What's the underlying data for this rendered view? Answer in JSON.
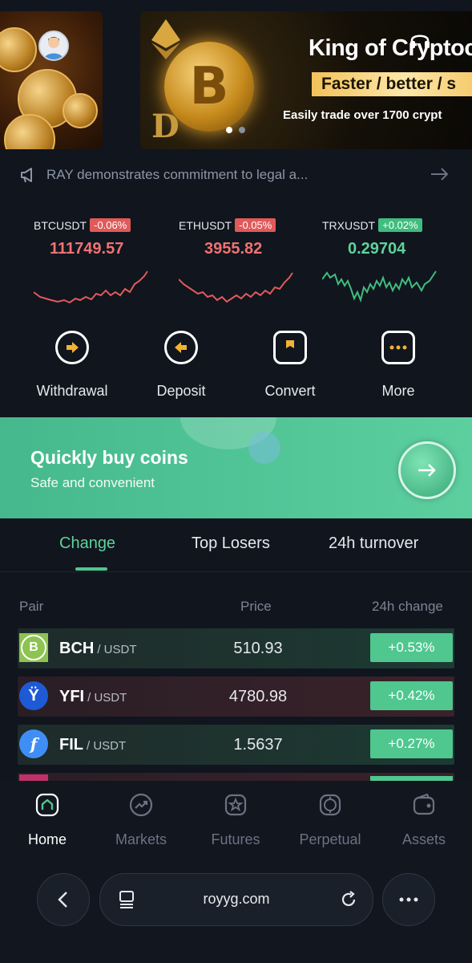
{
  "banner": {
    "title": "King of Cryptocu",
    "strip": "Faster / better  /  s",
    "subtitle": "Easily trade over 1700 crypt",
    "coin_glyph": "B",
    "active_slide": 1,
    "slide_count": 2
  },
  "announcement": {
    "text": "RAY demonstrates commitment to legal a..."
  },
  "tickers": [
    {
      "symbol": "BTCUSDT",
      "change": "-0.06%",
      "price": "111749.57",
      "direction": "down"
    },
    {
      "symbol": "ETHUSDT",
      "change": "-0.05%",
      "price": "3955.82",
      "direction": "down"
    },
    {
      "symbol": "TRXUSDT",
      "change": "+0.02%",
      "price": "0.29704",
      "direction": "up"
    }
  ],
  "actions": [
    {
      "label": "Withdrawal",
      "icon": "withdraw-icon"
    },
    {
      "label": "Deposit",
      "icon": "deposit-icon"
    },
    {
      "label": "Convert",
      "icon": "convert-icon"
    },
    {
      "label": "More",
      "icon": "more-icon"
    }
  ],
  "promo": {
    "title": "Quickly buy coins",
    "subtitle": "Safe and convenient"
  },
  "tabs": [
    {
      "label": "Change",
      "active": true
    },
    {
      "label": "Top Losers",
      "active": false
    },
    {
      "label": "24h turnover",
      "active": false
    }
  ],
  "table": {
    "headers": {
      "pair": "Pair",
      "price": "Price",
      "change": "24h change"
    },
    "rows": [
      {
        "base": "BCH",
        "quote": "/ USDT",
        "price": "510.93",
        "change": "+0.53%",
        "icon_color": "#8dc351",
        "icon_glyph": "B"
      },
      {
        "base": "YFI",
        "quote": "/ USDT",
        "price": "4780.98",
        "change": "+0.42%",
        "icon_color": "#1e5ad6",
        "icon_glyph": "Ÿ"
      },
      {
        "base": "FIL",
        "quote": "/ USDT",
        "price": "1.5637",
        "change": "+0.27%",
        "icon_color": "#3f8ef5",
        "icon_glyph": "f"
      }
    ]
  },
  "bottom_nav": [
    {
      "label": "Home",
      "icon": "home-icon",
      "active": true
    },
    {
      "label": "Markets",
      "icon": "markets-icon",
      "active": false
    },
    {
      "label": "Futures",
      "icon": "futures-icon",
      "active": false
    },
    {
      "label": "Perpetual",
      "icon": "perpetual-icon",
      "active": false
    },
    {
      "label": "Assets",
      "icon": "wallet-icon",
      "active": false
    }
  ],
  "browser": {
    "url": "royyg.com"
  },
  "colors": {
    "background": "#10151e",
    "accent_green": "#4fc78f",
    "down_red": "#f07272"
  }
}
